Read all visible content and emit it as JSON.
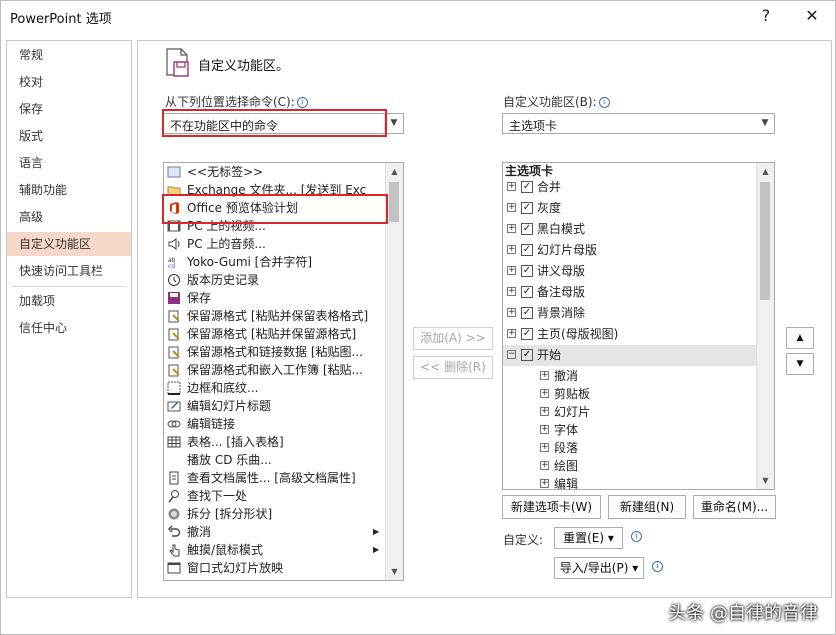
{
  "window": {
    "title": "PowerPoint 选项",
    "help": "?",
    "close": "✕"
  },
  "nav": {
    "items": [
      "常规",
      "校对",
      "保存",
      "版式",
      "语言",
      "辅助功能",
      "高级",
      "自定义功能区",
      "快速访问工具栏",
      "加载项",
      "信任中心"
    ],
    "selected": "自定义功能区"
  },
  "header": {
    "title": "自定义功能区。"
  },
  "left": {
    "label": "从下列位置选择命令(C):",
    "combo_value": "不在功能区中的命令",
    "commands": [
      "<<无标签>>",
      "Exchange 文件夹... [发送到 Exc",
      "Office 预览体验计划",
      "PC 上的视频...",
      "PC 上的音频...",
      "Yoko-Gumi [合并字符]",
      "版本历史记录",
      "保存",
      "保留源格式 [粘贴并保留表格格式]",
      "保留源格式 [粘贴并保留源格式]",
      "保留源格式和链接数据 [粘贴图...",
      "保留源格式和嵌入工作簿 [粘贴...",
      "边框和底纹...",
      "编辑幻灯片标题",
      "编辑链接",
      "表格... [插入表格]",
      "播放 CD 乐曲...",
      "查看文档属性... [高级文档属性]",
      "查找下一处",
      "拆分 [拆分形状]",
      "撤消",
      "触摸/鼠标模式",
      "窗口式幻灯片放映"
    ]
  },
  "middle": {
    "add": "添加(A) >>",
    "remove": "<< 删除(R)"
  },
  "right": {
    "label": "自定义功能区(B):",
    "combo_value": "主选项卡",
    "tree_header": "主选项卡",
    "tabs": [
      "合并",
      "灰度",
      "黑白模式",
      "幻灯片母版",
      "讲义母版",
      "备注母版",
      "背景消除",
      "主页(母版视图)",
      "开始"
    ],
    "groups": [
      "撤消",
      "剪贴板",
      "幻灯片",
      "字体",
      "段落",
      "绘图",
      "编辑"
    ],
    "new_tab": "新建选项卡(W)",
    "new_group": "新建组(N)",
    "rename": "重命名(M)...",
    "customize_label": "自定义:",
    "reset": "重置(E) ▾",
    "import_export": "导入/导出(P) ▾"
  },
  "watermark": "头条 @自律的音律",
  "colors": {
    "selected_nav": "#f5d8c8",
    "highlight_box": "#d9262a",
    "selected_tree": "#e5e5e5"
  }
}
